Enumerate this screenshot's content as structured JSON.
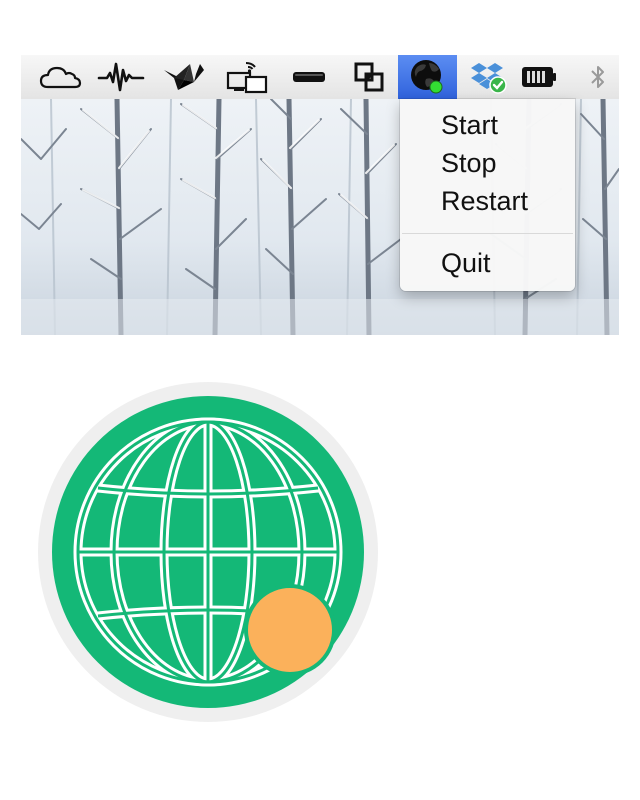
{
  "menubar": {
    "icons": [
      {
        "name": "cloud-icon"
      },
      {
        "name": "activity-monitor-icon"
      },
      {
        "name": "paper-crane-icon"
      },
      {
        "name": "airplay-display-icon"
      },
      {
        "name": "minus-bar-icon"
      },
      {
        "name": "window-switch-icon"
      },
      {
        "name": "globe-status-icon",
        "active": true,
        "status_color": "#33dd33"
      },
      {
        "name": "dropbox-synced-icon"
      },
      {
        "name": "battery-icon"
      },
      {
        "name": "bluetooth-icon"
      }
    ]
  },
  "dropdown": {
    "items": [
      {
        "label": "Start"
      },
      {
        "label": "Stop"
      },
      {
        "label": "Restart"
      },
      {
        "label": "Quit"
      }
    ]
  },
  "app_icon": {
    "name": "globe-app-icon",
    "background_color": "#14b877",
    "ring_color": "#efefef",
    "status_dot_color": "#fbb15b"
  }
}
